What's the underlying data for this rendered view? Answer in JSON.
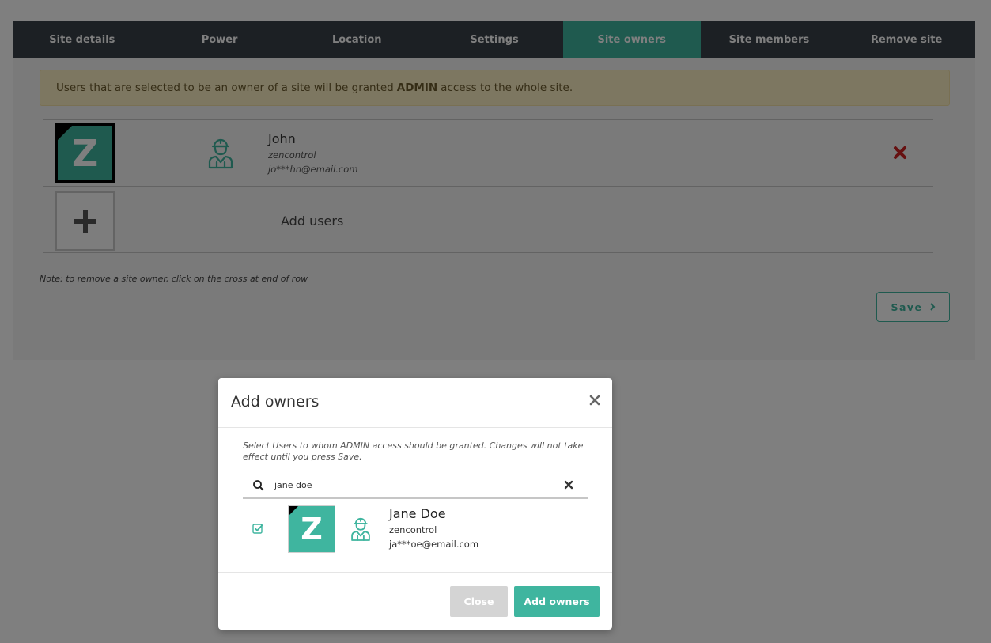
{
  "tabs": [
    {
      "label": "Site details"
    },
    {
      "label": "Power"
    },
    {
      "label": "Location"
    },
    {
      "label": "Settings"
    },
    {
      "label": "Site owners"
    },
    {
      "label": "Site members"
    },
    {
      "label": "Remove site"
    }
  ],
  "active_tab": "Site owners",
  "alert": {
    "text_before": "Users that are selected to be an owner of a site will be granted",
    "bold": "ADMIN",
    "text_after": "access to the whole site."
  },
  "owners": [
    {
      "avatar_letter": "Z",
      "name": "John",
      "org": "zencontrol",
      "email": "jo***hn@email.com",
      "role_icon": "worker-icon"
    }
  ],
  "add_users_label": "Add users",
  "note": "Note: to remove a site owner, click on the cross at end of row",
  "save_label": "Save",
  "modal": {
    "title": "Add owners",
    "description": "Select Users to whom ADMIN access should be granted. Changes will not take effect until you press Save.",
    "search_value": "jane doe",
    "results": [
      {
        "avatar_letter": "Z",
        "name": "Jane Doe",
        "org": "zencontrol",
        "email": "ja***oe@email.com",
        "checked": true,
        "role_icon": "worker-icon"
      }
    ],
    "close_label": "Close",
    "add_label": "Add owners"
  },
  "colors": {
    "accent": "#3fb59f",
    "tabbar": "#394048",
    "alert_bg": "#fbeec3",
    "remove": "#cc2222"
  }
}
